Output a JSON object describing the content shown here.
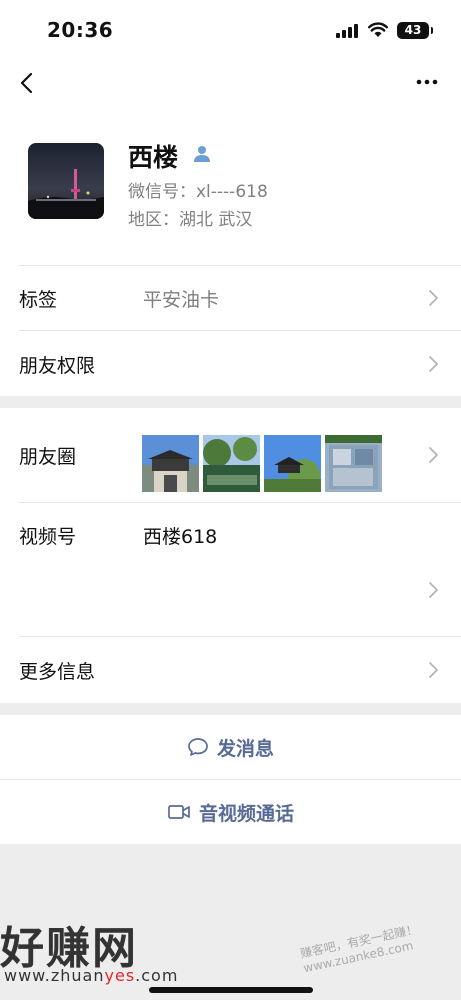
{
  "status_bar": {
    "time": "20:36",
    "battery": "43"
  },
  "profile": {
    "name": "西楼",
    "wechat_id": "微信号：xl----618",
    "region": "地区：湖北 武汉"
  },
  "rows": {
    "tags": {
      "label": "标签",
      "value": "平安油卡"
    },
    "permissions": {
      "label": "朋友权限"
    },
    "moments": {
      "label": "朋友圈"
    },
    "channels": {
      "label": "视频号",
      "value": "西楼618"
    },
    "more_info": {
      "label": "更多信息"
    }
  },
  "actions": {
    "message": "发消息",
    "call": "音视频通话"
  },
  "watermark": {
    "brand": "好赚网",
    "url_prefix": "www.zhuan",
    "url_highlight": "yes",
    "url_suffix": ".com",
    "slogan": "赚客吧，有奖一起赚！ www.zuanke8.com"
  },
  "colors": {
    "link": "#576b95",
    "secondary_text": "#808080",
    "background": "#ededed"
  }
}
